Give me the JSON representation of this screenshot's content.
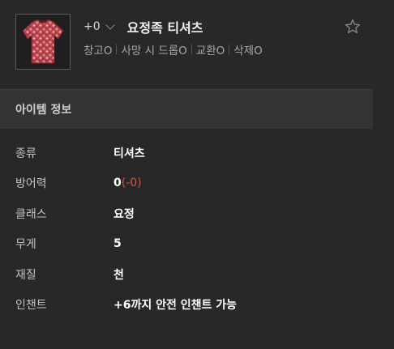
{
  "item": {
    "enchant_level": "+0",
    "name": "요정족 티셔츠",
    "icon": "red-floral-tshirt-icon",
    "flags": [
      "창고O",
      "사망 시 드롭O",
      "교환O",
      "삭제O"
    ]
  },
  "section": {
    "title": "아이템 정보"
  },
  "info": {
    "type": {
      "label": "종류",
      "value": "티셔츠"
    },
    "defense": {
      "label": "방어력",
      "value": "0",
      "delta": "(-0)"
    },
    "class": {
      "label": "클래스",
      "value": "요정"
    },
    "weight": {
      "label": "무게",
      "value": "5"
    },
    "material": {
      "label": "재질",
      "value": "천"
    },
    "enchant": {
      "label": "인챈트",
      "value": "+6까지 안전 인챈트 가능"
    }
  },
  "colors": {
    "background": "#282828",
    "section_header": "#333333",
    "delta_red": "#d2553e",
    "value_text": "#ffffff",
    "label_text": "#c2c2c2"
  }
}
